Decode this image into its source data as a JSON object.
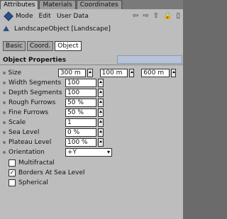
{
  "tabs": [
    "Attributes",
    "Materials",
    "Coordinates"
  ],
  "menu": [
    "Mode",
    "Edit",
    "User Data"
  ],
  "nav": [
    "⇦",
    "⇨",
    "⇧",
    "🔒",
    "▯"
  ],
  "object_line": "LandscapeObject [Landscape]",
  "subtabs": [
    "Basic",
    "Coord.",
    "Object"
  ],
  "section_title": "Object Properties",
  "rows": [
    {
      "label": "Size",
      "values": [
        "300 m",
        "100 m",
        "600 m"
      ]
    },
    {
      "label": "Width Segments",
      "value": "100"
    },
    {
      "label": "Depth Segments",
      "value": "100"
    },
    {
      "label": "Rough Furrows",
      "value": "50 %"
    },
    {
      "label": "Fine Furrows",
      "value": "50 %"
    },
    {
      "label": "Scale",
      "value": "1"
    },
    {
      "label": "Sea Level",
      "value": "0 %"
    },
    {
      "label": "Plateau Level",
      "value": "100 %"
    },
    {
      "label": "Orientation",
      "value": "+Y"
    }
  ],
  "checks": [
    {
      "label": "Multifractal",
      "checked": false
    },
    {
      "label": "Borders At Sea Level",
      "checked": true
    },
    {
      "label": "Spherical",
      "checked": false
    }
  ]
}
